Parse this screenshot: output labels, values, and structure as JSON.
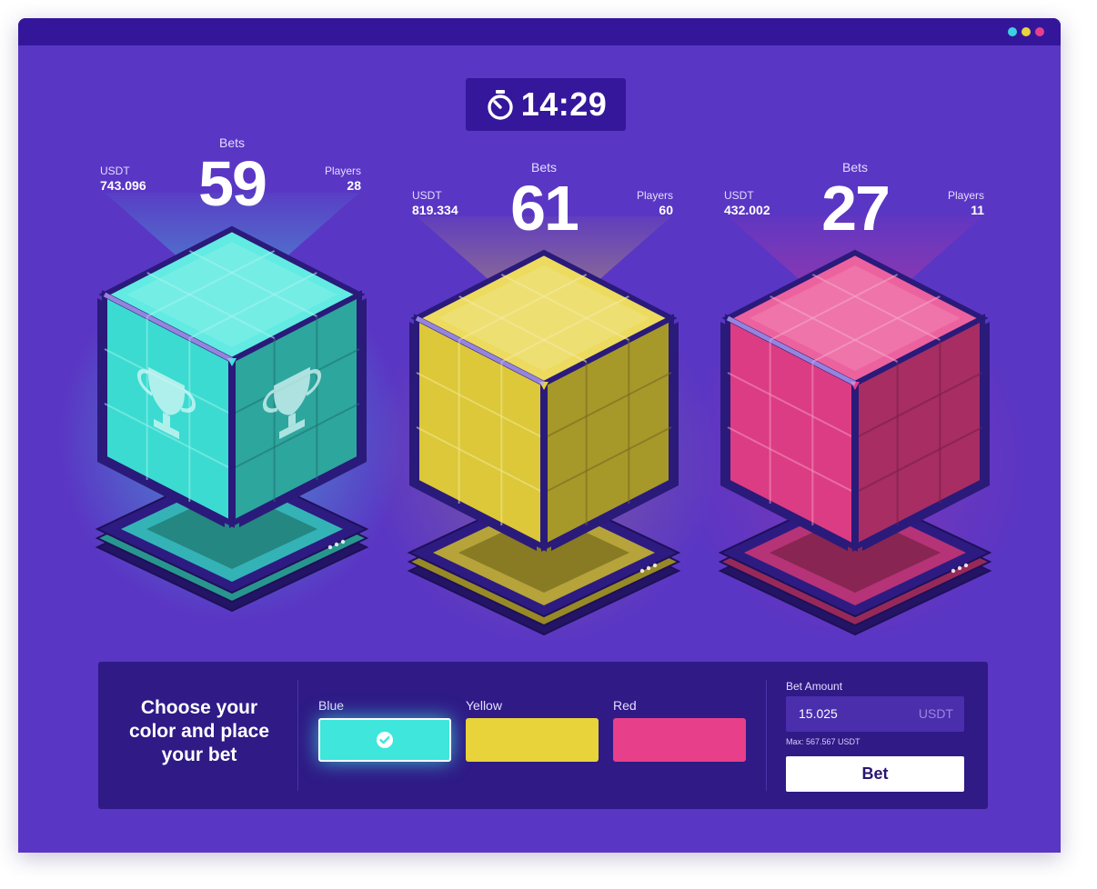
{
  "window": {
    "dots": [
      "#3ed0e0",
      "#e8d33b",
      "#e83f8a"
    ]
  },
  "timer": {
    "icon": "stopwatch-icon",
    "value": "14:29"
  },
  "cubes": [
    {
      "color_name": "Blue",
      "color": "#3ee6dc",
      "usdt_label": "USDT",
      "usdt_value": "743.096",
      "bets_label": "Bets",
      "bets": "59",
      "players_label": "Players",
      "players": "28",
      "selected": true
    },
    {
      "color_name": "Yellow",
      "color": "#e8d33b",
      "usdt_label": "USDT",
      "usdt_value": "819.334",
      "bets_label": "Bets",
      "bets": "61",
      "players_label": "Players",
      "players": "60",
      "selected": false
    },
    {
      "color_name": "Red",
      "color": "#e83f8a",
      "usdt_label": "USDT",
      "usdt_value": "432.002",
      "bets_label": "Bets",
      "bets": "27",
      "players_label": "Players",
      "players": "11",
      "selected": false
    }
  ],
  "panel": {
    "heading": "Choose your color and place your bet",
    "options": [
      {
        "label": "Blue",
        "color": "#3ee6dc",
        "selected": true
      },
      {
        "label": "Yellow",
        "color": "#e8d33b",
        "selected": false
      },
      {
        "label": "Red",
        "color": "#e83f8a",
        "selected": false
      }
    ],
    "bet_amount_label": "Bet Amount",
    "bet_amount_value": "15.025",
    "bet_amount_unit": "USDT",
    "max_text": "Max: 567.567 USDT",
    "bet_button": "Bet"
  }
}
